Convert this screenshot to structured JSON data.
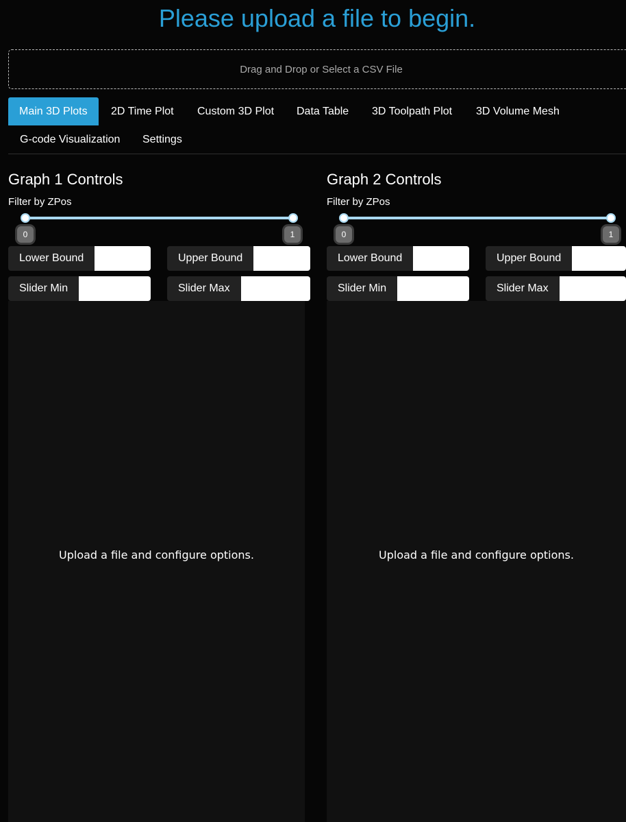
{
  "title": "Please upload a file to begin.",
  "upload": {
    "label": "Drag and Drop or Select a CSV File"
  },
  "tabs": [
    {
      "label": "Main 3D Plots",
      "active": true
    },
    {
      "label": "2D Time Plot"
    },
    {
      "label": "Custom 3D Plot"
    },
    {
      "label": "Data Table"
    },
    {
      "label": "3D Toolpath Plot"
    },
    {
      "label": "3D Volume Mesh"
    },
    {
      "label": "G-code Visualization"
    },
    {
      "label": "Settings"
    }
  ],
  "graph1": {
    "heading": "Graph 1 Controls",
    "filter_label": "Filter by ZPos",
    "slider": {
      "min_label": "0",
      "max_label": "1"
    },
    "lower_bound_label": "Lower Bound",
    "upper_bound_label": "Upper Bound",
    "slider_min_label": "Slider Min",
    "slider_max_label": "Slider Max",
    "placeholder": "Upload a file and configure options."
  },
  "graph2": {
    "heading": "Graph 2 Controls",
    "filter_label": "Filter by ZPos",
    "slider": {
      "min_label": "0",
      "max_label": "1"
    },
    "lower_bound_label": "Lower Bound",
    "upper_bound_label": "Upper Bound",
    "slider_min_label": "Slider Min",
    "slider_max_label": "Slider Max",
    "placeholder": "Upload a file and configure options."
  },
  "colors": {
    "accent": "#2a9fd6",
    "background": "#060606",
    "panel": "#111111",
    "track": "#a8d8f0"
  }
}
